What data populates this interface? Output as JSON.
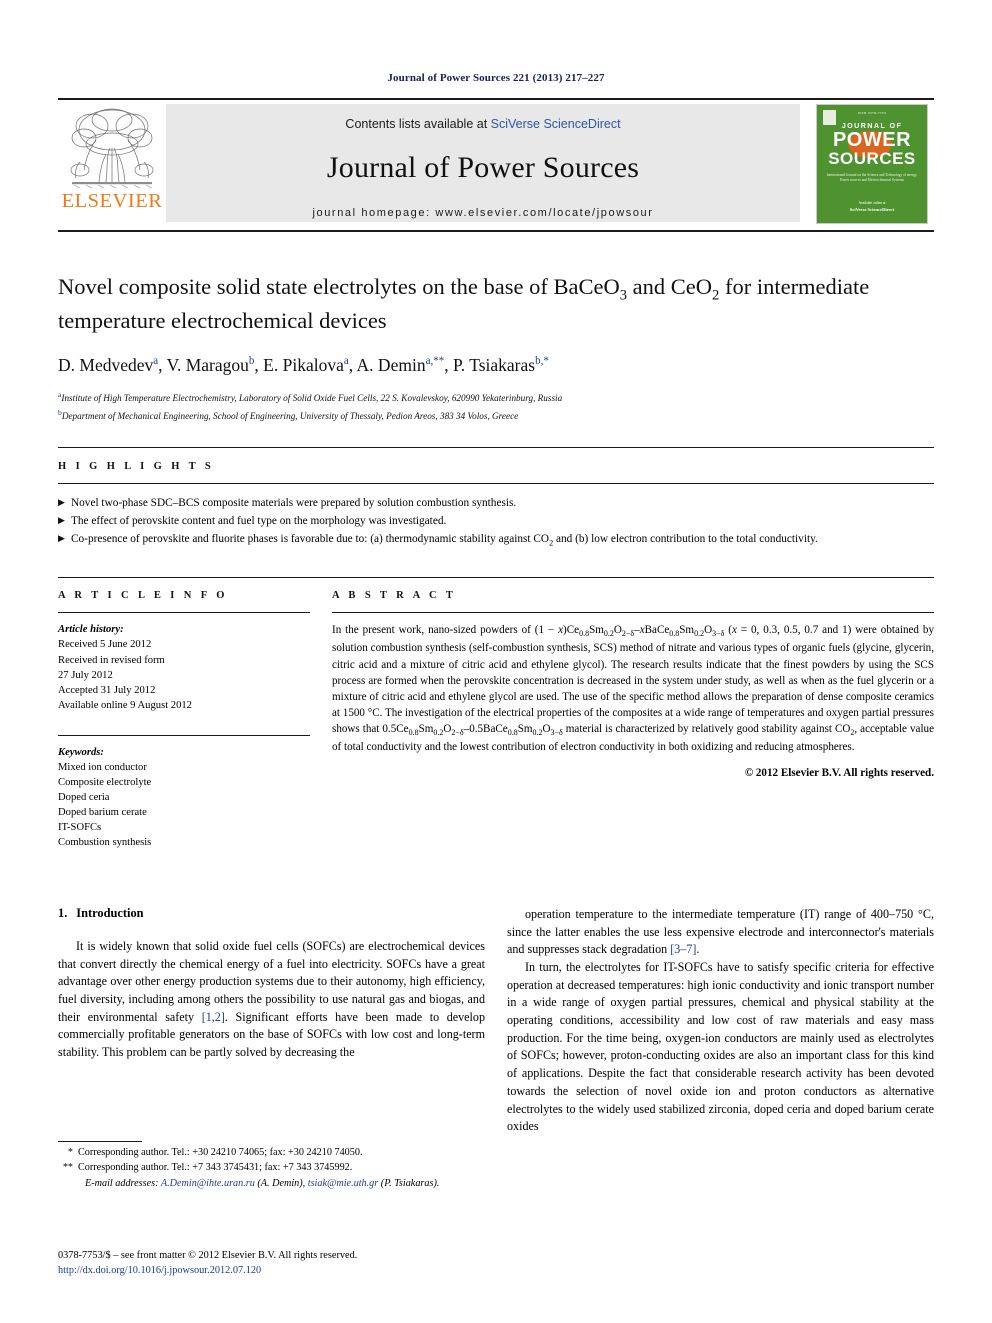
{
  "running_head": "Journal of Power Sources 221 (2013) 217–227",
  "masthead": {
    "publisher_logo_text": "ELSEVIER",
    "contents_prefix": "Contents lists available at ",
    "contents_link": "SciVerse ScienceDirect",
    "journal_name": "Journal of Power Sources",
    "homepage_label": "journal homepage: www.elsevier.com/locate/jpowsour",
    "cover": {
      "top_line": "ISSN 0378-7753",
      "journal_of": "JOURNAL OF",
      "power": "POWER",
      "sources": "SOURCES",
      "subtitle": "International Journal on the Science and Technology of energy, Power sources and Electrochemical Systems",
      "footer_label": "Available online at",
      "footer_brand": "SciVerse ScienceDirect"
    }
  },
  "article": {
    "title_part1": "Novel composite solid state electrolytes on the base of BaCeO",
    "title_sub1": "3",
    "title_part2": " and CeO",
    "title_sub2": "2",
    "title_part3": " for intermediate temperature electrochemical devices",
    "authors": [
      {
        "name": "D. Medvedev",
        "sup": "a"
      },
      {
        "name": "V. Maragou",
        "sup": "b"
      },
      {
        "name": "E. Pikalova",
        "sup": "a"
      },
      {
        "name": "A. Demin",
        "sup": "a,**"
      },
      {
        "name": "P. Tsiakaras",
        "sup": "b,*"
      }
    ],
    "affiliations": [
      {
        "mark": "a",
        "text": "Institute of High Temperature Electrochemistry, Laboratory of Solid Oxide Fuel Cells, 22 S. Kovalevskoy, 620990 Yekaterinburg, Russia"
      },
      {
        "mark": "b",
        "text": "Department of Mechanical Engineering, School of Engineering, University of Thessaly, Pedion Areos, 383 34 Volos, Greece"
      }
    ]
  },
  "highlights": {
    "heading": "H I G H L I G H T S",
    "items": [
      {
        "pre": "Novel two-phase SDC–BCS composite materials were prepared by solution combustion synthesis.",
        "sub": "",
        "post": ""
      },
      {
        "pre": "The effect of perovskite content and fuel type on the morphology was investigated.",
        "sub": "",
        "post": ""
      },
      {
        "pre": "Co-presence of perovskite and fluorite phases is favorable due to: (a) thermodynamic stability against CO",
        "sub": "2",
        "post": " and (b) low electron contribution to the total conductivity."
      }
    ]
  },
  "article_info": {
    "heading": "A R T I C L E   I N F O",
    "history_label": "Article history:",
    "history": [
      "Received 5 June 2012",
      "Received in revised form",
      "27 July 2012",
      "Accepted 31 July 2012",
      "Available online 9 August 2012"
    ],
    "keywords_label": "Keywords:",
    "keywords": [
      "Mixed ion conductor",
      "Composite electrolyte",
      "Doped ceria",
      "Doped barium cerate",
      "IT-SOFCs",
      "Combustion synthesis"
    ]
  },
  "abstract": {
    "heading": "A B S T R A C T",
    "paragraph_segments": [
      {
        "t": "In the present work, nano-sized powders of (1 − "
      },
      {
        "t": "x",
        "i": true
      },
      {
        "t": ")Ce"
      },
      {
        "t": "0.8",
        "sub": true
      },
      {
        "t": "Sm"
      },
      {
        "t": "0.2",
        "sub": true
      },
      {
        "t": "O"
      },
      {
        "t": "2−δ",
        "sub": true
      },
      {
        "t": "–"
      },
      {
        "t": "x",
        "i": true
      },
      {
        "t": "BaCe"
      },
      {
        "t": "0.8",
        "sub": true
      },
      {
        "t": "Sm"
      },
      {
        "t": "0.2",
        "sub": true
      },
      {
        "t": "O"
      },
      {
        "t": "3−δ",
        "sub": true
      },
      {
        "t": " ("
      },
      {
        "t": "x",
        "i": true
      },
      {
        "t": " = 0, 0.3, 0.5, 0.7 and 1) were obtained by solution combustion synthesis (self-combustion synthesis, SCS) method of nitrate and various types of organic fuels (glycine, glycerin, citric acid and a mixture of citric acid and ethylene glycol). The research results indicate that the finest powders by using the SCS process are formed when the perovskite concentration is decreased in the system under study, as well as when as the fuel glycerin or a mixture of citric acid and ethylene glycol are used. The use of the specific method allows the preparation of dense composite ceramics at 1500 °C. The investigation of the electrical properties of the composites at a wide range of temperatures and oxygen partial pressures shows that 0.5Ce"
      },
      {
        "t": "0.8",
        "sub": true
      },
      {
        "t": "Sm"
      },
      {
        "t": "0.2",
        "sub": true
      },
      {
        "t": "O"
      },
      {
        "t": "2−δ",
        "sub": true
      },
      {
        "t": "–0.5BaCe"
      },
      {
        "t": "0.8",
        "sub": true
      },
      {
        "t": "Sm"
      },
      {
        "t": "0.2",
        "sub": true
      },
      {
        "t": "O"
      },
      {
        "t": "3−δ",
        "sub": true
      },
      {
        "t": " material is characterized by relatively good stability against CO"
      },
      {
        "t": "2",
        "sub": true
      },
      {
        "t": ", acceptable value of total conductivity and the lowest contribution of electron conductivity in both oxidizing and reducing atmospheres."
      }
    ],
    "copyright": "© 2012 Elsevier B.V. All rights reserved."
  },
  "body": {
    "section_number": "1.",
    "section_title": "Introduction",
    "left_paragraph_segments": [
      {
        "t": "It is widely known that solid oxide fuel cells (SOFCs) are electrochemical devices that convert directly the chemical energy of a fuel into electricity. SOFCs have a great advantage over other energy production systems due to their autonomy, high efficiency, fuel diversity, including among others the possibility to use natural gas and biogas, and their environmental safety "
      },
      {
        "t": "[1,2]",
        "ref": true
      },
      {
        "t": ". Significant efforts have been made to develop commercially profitable generators on the base of SOFCs with low cost and long-term stability. This problem can be partly solved by decreasing the "
      }
    ],
    "right_paragraph1_segments": [
      {
        "t": "operation temperature to the intermediate temperature (IT) range of 400–750 °C, since the latter enables the use less expensive electrode and interconnector's materials and suppresses stack degradation "
      },
      {
        "t": "[3–7]",
        "ref": true
      },
      {
        "t": "."
      }
    ],
    "right_paragraph2_segments": [
      {
        "t": "In turn, the electrolytes for IT-SOFCs have to satisfy specific criteria for effective operation at decreased temperatures: high ionic conductivity and ionic transport number in a wide range of oxygen partial pressures, chemical and physical stability at the operating conditions, accessibility and low cost of raw materials and easy mass production. For the time being, oxygen-ion conductors are mainly used as electrolytes of SOFCs; however, proton-conducting oxides are also an important class for this kind of applications. Despite the fact that considerable research activity has been devoted towards the selection of novel oxide ion and proton conductors as alternative electrolytes to the widely used stabilized zirconia, doped ceria and doped barium cerate oxides"
      }
    ]
  },
  "footnotes": {
    "note1_mark": "*",
    "note1_text": "Corresponding author. Tel.: +30 24210 74065; fax: +30 24210 74050.",
    "note2_mark": "**",
    "note2_text": "Corresponding author. Tel.: +7 343 3745431; fax: +7 343 3745992.",
    "email_label": "E-mail addresses:",
    "email1": "A.Demin@ihte.uran.ru",
    "email1_owner": "(A. Demin)",
    "email2": "tsiak@mie.uth.gr",
    "email2_owner": "(P. Tsiakaras)."
  },
  "imprint": {
    "issn_line": "0378-7753/$ – see front matter © 2012 Elsevier B.V. All rights reserved.",
    "doi_line": "http://dx.doi.org/10.1016/j.jpowsour.2012.07.120"
  },
  "colors": {
    "running_head": "#17205c",
    "link": "#1f3a93",
    "elsevier_orange": "#f07c19",
    "cover_green": "#4f9330",
    "cover_accent": "#e2621f",
    "masthead_grey": "#e8e8e8"
  }
}
